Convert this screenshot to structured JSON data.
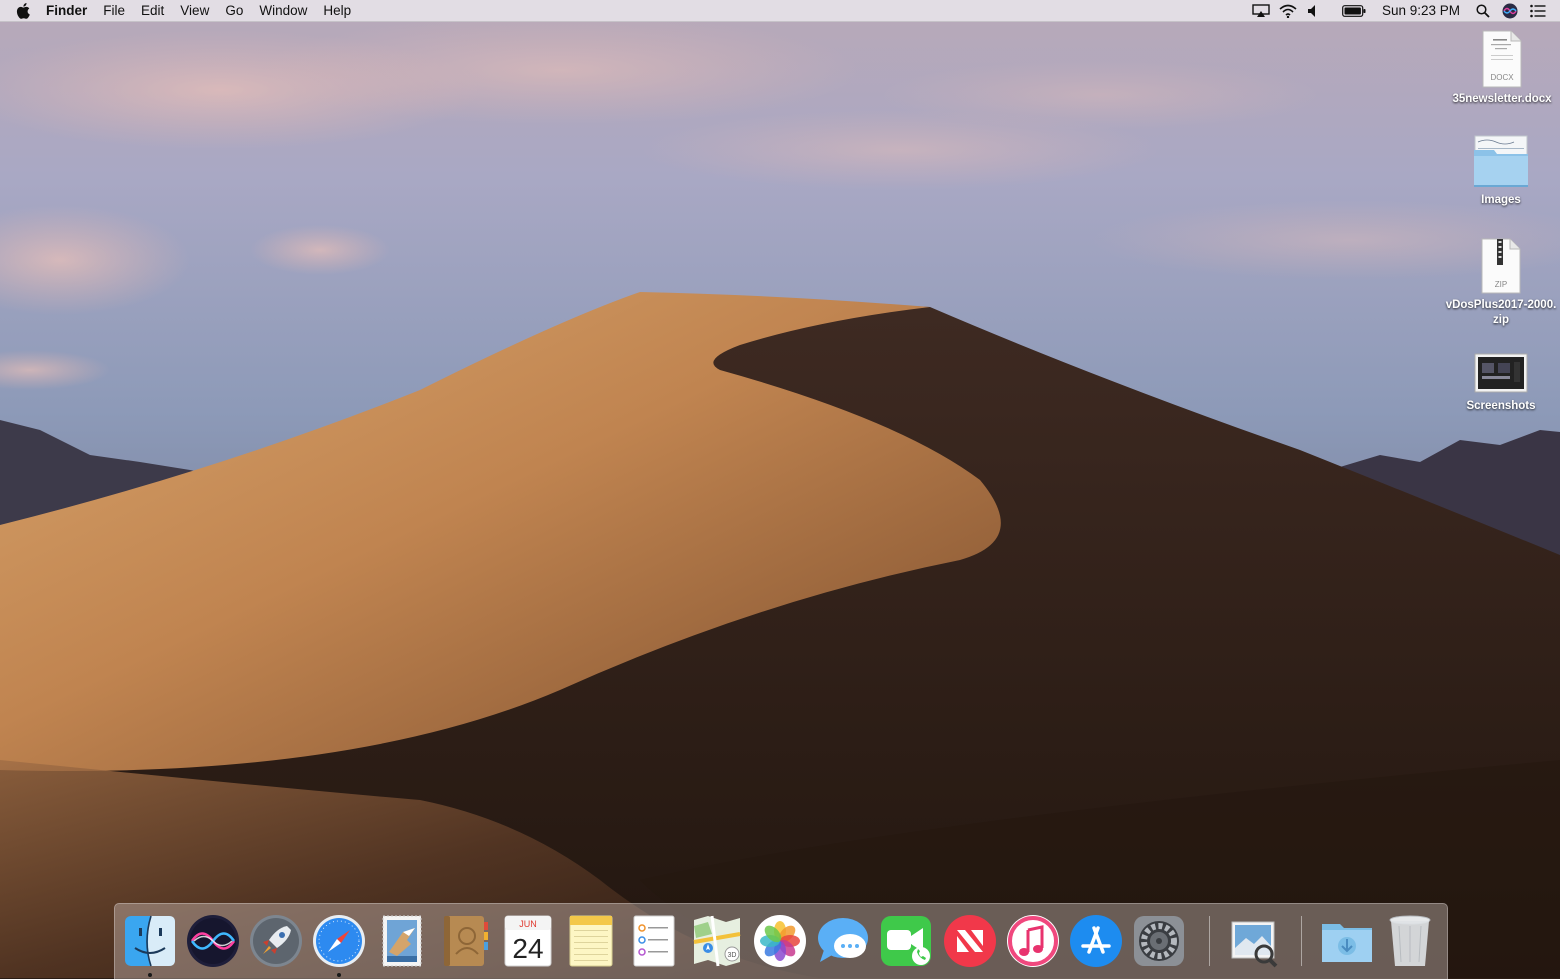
{
  "menubar": {
    "app_name": "Finder",
    "menus": [
      "File",
      "Edit",
      "View",
      "Go",
      "Window",
      "Help"
    ],
    "clock": "Sun 9:23 PM",
    "status_icons": [
      "airplay-icon",
      "wifi-icon",
      "volume-icon",
      "battery-icon",
      "spotlight-icon",
      "siri-icon",
      "notification-center-icon"
    ]
  },
  "desktop": {
    "items": [
      {
        "name": "35newsletter.docx",
        "badge": "DOCX"
      },
      {
        "name": "Images"
      },
      {
        "name": "vDosPlus2017-2000.zip",
        "badge": "ZIP"
      },
      {
        "name": "Screenshots"
      }
    ]
  },
  "dock": {
    "apps": [
      "finder",
      "siri",
      "launchpad",
      "safari",
      "mail",
      "contacts",
      "calendar",
      "notes",
      "reminders",
      "maps",
      "photos",
      "messages",
      "facetime",
      "news",
      "itunes",
      "app-store",
      "system-preferences",
      "preview",
      "downloads",
      "trash"
    ],
    "calendar_month": "JUN",
    "calendar_day": "24",
    "maps_badge": "3D",
    "running": [
      "finder",
      "safari"
    ]
  }
}
